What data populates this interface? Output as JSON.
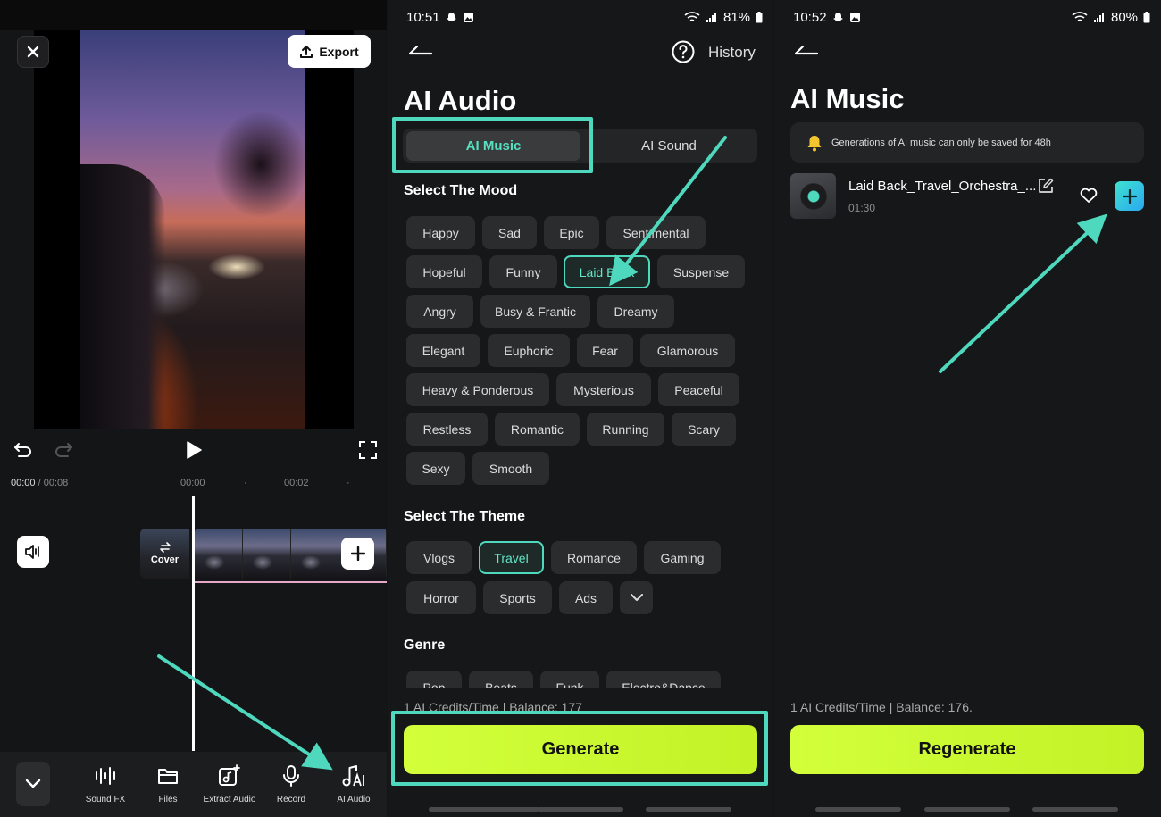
{
  "editor": {
    "export_label": "Export",
    "time_current": "00:00",
    "time_total": "/ 00:08",
    "tick_0": "00:00",
    "tick_2": "00:02",
    "cover_label": "Cover",
    "tools": [
      {
        "label": "Sound FX",
        "icon": "sound-fx-icon"
      },
      {
        "label": "Files",
        "icon": "folder-icon"
      },
      {
        "label": "Extract Audio",
        "icon": "extract-audio-icon"
      },
      {
        "label": "Record",
        "icon": "microphone-icon"
      },
      {
        "label": "AI Audio",
        "icon": "ai-audio-icon"
      }
    ]
  },
  "ai_audio": {
    "status_time": "10:51",
    "battery": "81%",
    "history_label": "History",
    "title": "AI Audio",
    "tabs": [
      {
        "label": "AI Music",
        "selected": true
      },
      {
        "label": "AI Sound",
        "selected": false
      }
    ],
    "mood_heading": "Select The Mood",
    "moods": [
      "Happy",
      "Sad",
      "Epic",
      "Sentimental",
      "Hopeful",
      "Funny",
      "Laid Back",
      "Suspense",
      "Angry",
      "Busy & Frantic",
      "Dreamy",
      "Elegant",
      "Euphoric",
      "Fear",
      "Glamorous",
      "Heavy & Ponderous",
      "Mysterious",
      "Peaceful",
      "Restless",
      "Romantic",
      "Running",
      "Scary",
      "Sexy",
      "Smooth"
    ],
    "selected_mood": "Laid Back",
    "theme_heading": "Select The Theme",
    "themes": [
      "Vlogs",
      "Travel",
      "Romance",
      "Gaming",
      "Horror",
      "Sports",
      "Ads"
    ],
    "selected_theme": "Travel",
    "genre_heading": "Genre",
    "genres": [
      "Pop",
      "Beats",
      "Funk",
      "Electro&Dance"
    ],
    "credits": "1 AI Credits/Time | Balance: 177",
    "generate_label": "Generate"
  },
  "ai_music": {
    "status_time": "10:52",
    "battery": "80%",
    "title": "AI Music",
    "notice": "Generations of AI music can only be saved for 48h",
    "track_title": "Laid Back_Travel_Orchestra_...",
    "track_duration": "01:30",
    "credits": "1 AI Credits/Time | Balance: 176.",
    "regenerate_label": "Regenerate"
  },
  "colors": {
    "accent": "#4ed8bd",
    "button": "#c9f72e",
    "chip": "#2b2c2e"
  }
}
